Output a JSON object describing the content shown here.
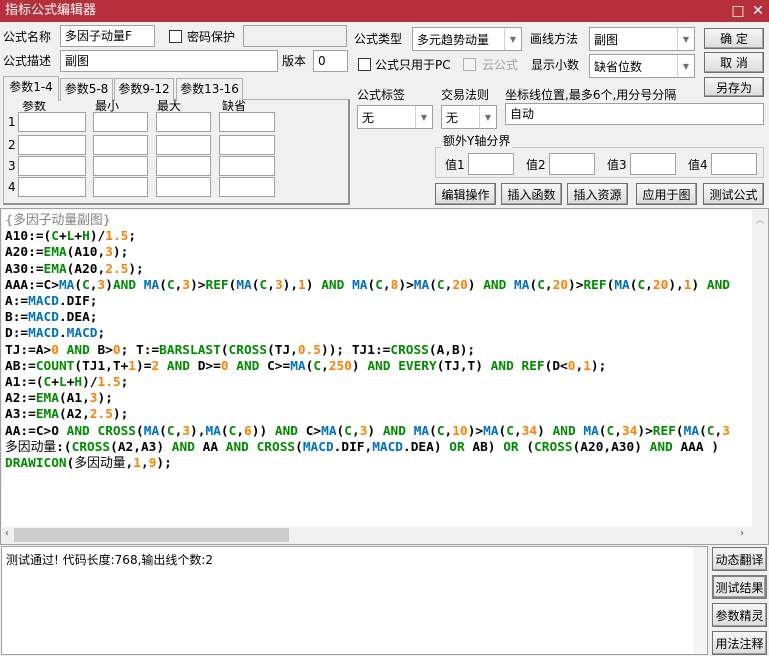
{
  "window": {
    "title": "指标公式编辑器",
    "maximize_icon": "□",
    "close_icon": "✕"
  },
  "form": {
    "name_label": "公式名称",
    "name_value": "多因子动量F",
    "password_label": "密码保护",
    "password_checked": false,
    "desc_label": "公式描述",
    "desc_value": "副图",
    "version_label": "版本",
    "version_value": "0",
    "type_label": "公式类型",
    "type_value": "多元趋势动量",
    "draw_label": "画线方法",
    "draw_value": "副图",
    "pc_only_label": "公式只用于PC",
    "pc_only_checked": false,
    "cloud_label": "云公式",
    "cloud_checked": false,
    "decimals_label": "显示小数",
    "decimals_value": "缺省位数",
    "tag_label": "公式标签",
    "tag_value": "无",
    "rule_label": "交易法则",
    "rule_value": "无",
    "axis_label": "坐标线位置,最多6个,用分号分隔",
    "axis_value": "自动",
    "yaxis_group": "额外Y轴分界",
    "yaxis_values": [
      {
        "label": "值1",
        "value": ""
      },
      {
        "label": "值2",
        "value": ""
      },
      {
        "label": "值3",
        "value": ""
      },
      {
        "label": "值4",
        "value": ""
      }
    ]
  },
  "buttons": {
    "ok": "确  定",
    "cancel": "取  消",
    "save_as": "另存为",
    "edit": "编辑操作",
    "insert_func": "插入函数",
    "insert_res": "插入资源",
    "apply": "应用于图",
    "test": "测试公式"
  },
  "params": {
    "tabs": [
      "参数1-4",
      "参数5-8",
      "参数9-12",
      "参数13-16"
    ],
    "active_tab": 0,
    "headers": [
      "参数",
      "最小",
      "最大",
      "缺省"
    ],
    "rows": [
      "1",
      "2",
      "3",
      "4"
    ]
  },
  "code_lines": [
    [
      [
        "{多因子动量副图}",
        "c"
      ]
    ],
    [
      [
        "A10:=(",
        "t"
      ],
      [
        "C",
        "k"
      ],
      [
        "+",
        "t"
      ],
      [
        "L",
        "k"
      ],
      [
        "+",
        "t"
      ],
      [
        "H",
        "k"
      ],
      [
        ")/",
        "t"
      ],
      [
        "1.5",
        "n"
      ],
      [
        ";",
        "t"
      ]
    ],
    [
      [
        "A20:=",
        "t"
      ],
      [
        "EMA",
        "k"
      ],
      [
        "(A10,",
        "t"
      ],
      [
        "3",
        "n"
      ],
      [
        ");",
        "t"
      ]
    ],
    [
      [
        "A30:=",
        "t"
      ],
      [
        "EMA",
        "k"
      ],
      [
        "(A20,",
        "t"
      ],
      [
        "2.5",
        "n"
      ],
      [
        ");",
        "t"
      ]
    ],
    [
      [
        "AAA:=C>",
        "t"
      ],
      [
        "MA",
        "f"
      ],
      [
        "(",
        "t"
      ],
      [
        "C",
        "k"
      ],
      [
        ",",
        "t"
      ],
      [
        "3",
        "n"
      ],
      [
        ")",
        "t"
      ],
      [
        "AND",
        "k"
      ],
      [
        " ",
        "t"
      ],
      [
        "MA",
        "f"
      ],
      [
        "(",
        "t"
      ],
      [
        "C",
        "k"
      ],
      [
        ",",
        "t"
      ],
      [
        "3",
        "n"
      ],
      [
        ")>",
        "t"
      ],
      [
        "REF",
        "k"
      ],
      [
        "(",
        "t"
      ],
      [
        "MA",
        "f"
      ],
      [
        "(",
        "t"
      ],
      [
        "C",
        "k"
      ],
      [
        ",",
        "t"
      ],
      [
        "3",
        "n"
      ],
      [
        "),",
        "t"
      ],
      [
        "1",
        "n"
      ],
      [
        ") ",
        "t"
      ],
      [
        "AND",
        "k"
      ],
      [
        " ",
        "t"
      ],
      [
        "MA",
        "f"
      ],
      [
        "(",
        "t"
      ],
      [
        "C",
        "k"
      ],
      [
        ",",
        "t"
      ],
      [
        "8",
        "n"
      ],
      [
        ")>",
        "t"
      ],
      [
        "MA",
        "f"
      ],
      [
        "(",
        "t"
      ],
      [
        "C",
        "k"
      ],
      [
        ",",
        "t"
      ],
      [
        "20",
        "n"
      ],
      [
        ") ",
        "t"
      ],
      [
        "AND",
        "k"
      ],
      [
        " ",
        "t"
      ],
      [
        "MA",
        "f"
      ],
      [
        "(",
        "t"
      ],
      [
        "C",
        "k"
      ],
      [
        ",",
        "t"
      ],
      [
        "20",
        "n"
      ],
      [
        ")>",
        "t"
      ],
      [
        "REF",
        "k"
      ],
      [
        "(",
        "t"
      ],
      [
        "MA",
        "f"
      ],
      [
        "(",
        "t"
      ],
      [
        "C",
        "k"
      ],
      [
        ",",
        "t"
      ],
      [
        "20",
        "n"
      ],
      [
        "),",
        "t"
      ],
      [
        "1",
        "n"
      ],
      [
        ") ",
        "t"
      ],
      [
        "AND",
        "k"
      ]
    ],
    [
      [
        "A:=",
        "t"
      ],
      [
        "MACD",
        "f"
      ],
      [
        ".DIF;",
        "t"
      ]
    ],
    [
      [
        "B:=",
        "t"
      ],
      [
        "MACD",
        "f"
      ],
      [
        ".DEA;",
        "t"
      ]
    ],
    [
      [
        "D:=",
        "t"
      ],
      [
        "MACD",
        "f"
      ],
      [
        ".",
        "t"
      ],
      [
        "MACD",
        "f"
      ],
      [
        ";",
        "t"
      ]
    ],
    [
      [
        "TJ:=A>",
        "t"
      ],
      [
        "0",
        "n"
      ],
      [
        " ",
        "t"
      ],
      [
        "AND",
        "k"
      ],
      [
        " B>",
        "t"
      ],
      [
        "0",
        "n"
      ],
      [
        "; T:=",
        "t"
      ],
      [
        "BARSLAST",
        "k"
      ],
      [
        "(",
        "t"
      ],
      [
        "CROSS",
        "k"
      ],
      [
        "(TJ,",
        "t"
      ],
      [
        "0.5",
        "n"
      ],
      [
        ")); TJ1:=",
        "t"
      ],
      [
        "CROSS",
        "k"
      ],
      [
        "(A,B);",
        "t"
      ]
    ],
    [
      [
        "AB:=",
        "t"
      ],
      [
        "COUNT",
        "k"
      ],
      [
        "(TJ1,T+",
        "t"
      ],
      [
        "1",
        "n"
      ],
      [
        ")=",
        "t"
      ],
      [
        "2",
        "n"
      ],
      [
        " ",
        "t"
      ],
      [
        "AND",
        "k"
      ],
      [
        " D>=",
        "t"
      ],
      [
        "0",
        "n"
      ],
      [
        " ",
        "t"
      ],
      [
        "AND",
        "k"
      ],
      [
        " C>=",
        "t"
      ],
      [
        "MA",
        "f"
      ],
      [
        "(",
        "t"
      ],
      [
        "C",
        "k"
      ],
      [
        ",",
        "t"
      ],
      [
        "250",
        "n"
      ],
      [
        ") ",
        "t"
      ],
      [
        "AND",
        "k"
      ],
      [
        " ",
        "t"
      ],
      [
        "EVERY",
        "k"
      ],
      [
        "(TJ,T) ",
        "t"
      ],
      [
        "AND",
        "k"
      ],
      [
        " ",
        "t"
      ],
      [
        "REF",
        "k"
      ],
      [
        "(D<",
        "t"
      ],
      [
        "0",
        "n"
      ],
      [
        ",",
        "t"
      ],
      [
        "1",
        "n"
      ],
      [
        ");",
        "t"
      ]
    ],
    [
      [
        "A1:=(",
        "t"
      ],
      [
        "C",
        "k"
      ],
      [
        "+",
        "t"
      ],
      [
        "L",
        "k"
      ],
      [
        "+",
        "t"
      ],
      [
        "H",
        "k"
      ],
      [
        ")/",
        "t"
      ],
      [
        "1.5",
        "n"
      ],
      [
        ";",
        "t"
      ]
    ],
    [
      [
        "A2:=",
        "t"
      ],
      [
        "EMA",
        "k"
      ],
      [
        "(A1,",
        "t"
      ],
      [
        "3",
        "n"
      ],
      [
        ");",
        "t"
      ]
    ],
    [
      [
        "A3:=",
        "t"
      ],
      [
        "EMA",
        "k"
      ],
      [
        "(A2,",
        "t"
      ],
      [
        "2.5",
        "n"
      ],
      [
        ");",
        "t"
      ]
    ],
    [
      [
        "AA:=C>O ",
        "t"
      ],
      [
        "AND",
        "k"
      ],
      [
        " ",
        "t"
      ],
      [
        "CROSS",
        "k"
      ],
      [
        "(",
        "t"
      ],
      [
        "MA",
        "f"
      ],
      [
        "(",
        "t"
      ],
      [
        "C",
        "k"
      ],
      [
        ",",
        "t"
      ],
      [
        "3",
        "n"
      ],
      [
        "),",
        "t"
      ],
      [
        "MA",
        "f"
      ],
      [
        "(",
        "t"
      ],
      [
        "C",
        "k"
      ],
      [
        ",",
        "t"
      ],
      [
        "6",
        "n"
      ],
      [
        ")) ",
        "t"
      ],
      [
        "AND",
        "k"
      ],
      [
        " C>",
        "t"
      ],
      [
        "MA",
        "f"
      ],
      [
        "(",
        "t"
      ],
      [
        "C",
        "k"
      ],
      [
        ",",
        "t"
      ],
      [
        "3",
        "n"
      ],
      [
        ") ",
        "t"
      ],
      [
        "AND",
        "k"
      ],
      [
        " ",
        "t"
      ],
      [
        "MA",
        "f"
      ],
      [
        "(",
        "t"
      ],
      [
        "C",
        "k"
      ],
      [
        ",",
        "t"
      ],
      [
        "10",
        "n"
      ],
      [
        ")>",
        "t"
      ],
      [
        "MA",
        "f"
      ],
      [
        "(",
        "t"
      ],
      [
        "C",
        "k"
      ],
      [
        ",",
        "t"
      ],
      [
        "34",
        "n"
      ],
      [
        ") ",
        "t"
      ],
      [
        "AND",
        "k"
      ],
      [
        " ",
        "t"
      ],
      [
        "MA",
        "f"
      ],
      [
        "(",
        "t"
      ],
      [
        "C",
        "k"
      ],
      [
        ",",
        "t"
      ],
      [
        "34",
        "n"
      ],
      [
        ")>",
        "t"
      ],
      [
        "REF",
        "k"
      ],
      [
        "(",
        "t"
      ],
      [
        "MA",
        "f"
      ],
      [
        "(",
        "t"
      ],
      [
        "C",
        "k"
      ],
      [
        ",",
        "t"
      ],
      [
        "3",
        "n"
      ]
    ],
    [
      [
        "多因动量",
        "cn"
      ],
      [
        ":(",
        "t"
      ],
      [
        "CROSS",
        "k"
      ],
      [
        "(A2,A3) ",
        "t"
      ],
      [
        "AND",
        "k"
      ],
      [
        " AA ",
        "t"
      ],
      [
        "AND",
        "k"
      ],
      [
        " ",
        "t"
      ],
      [
        "CROSS",
        "k"
      ],
      [
        "(",
        "t"
      ],
      [
        "MACD",
        "f"
      ],
      [
        ".DIF,",
        "t"
      ],
      [
        "MACD",
        "f"
      ],
      [
        ".DEA) ",
        "t"
      ],
      [
        "OR",
        "k"
      ],
      [
        " AB) ",
        "t"
      ],
      [
        "OR",
        "k"
      ],
      [
        " (",
        "t"
      ],
      [
        "CROSS",
        "k"
      ],
      [
        "(A20,A30) ",
        "t"
      ],
      [
        "AND",
        "k"
      ],
      [
        " AAA )",
        "t"
      ]
    ],
    [
      [
        "DRAWICON",
        "k"
      ],
      [
        "(",
        "t"
      ],
      [
        "多因动量",
        "cn"
      ],
      [
        ",",
        "t"
      ],
      [
        "1",
        "n"
      ],
      [
        ",",
        "t"
      ],
      [
        "9",
        "n"
      ],
      [
        ");",
        "t"
      ]
    ]
  ],
  "output": {
    "message": "测试通过! 代码长度:768,输出线个数:2"
  },
  "side_buttons": [
    "动态翻译",
    "测试结果",
    "参数精灵",
    "用法注释"
  ],
  "active_side_button": 1,
  "colors": {
    "titlebar": "#b5303a",
    "keyword": "#008c00",
    "function": "#0070c0",
    "number": "#ff8000",
    "comment": "#808080"
  }
}
